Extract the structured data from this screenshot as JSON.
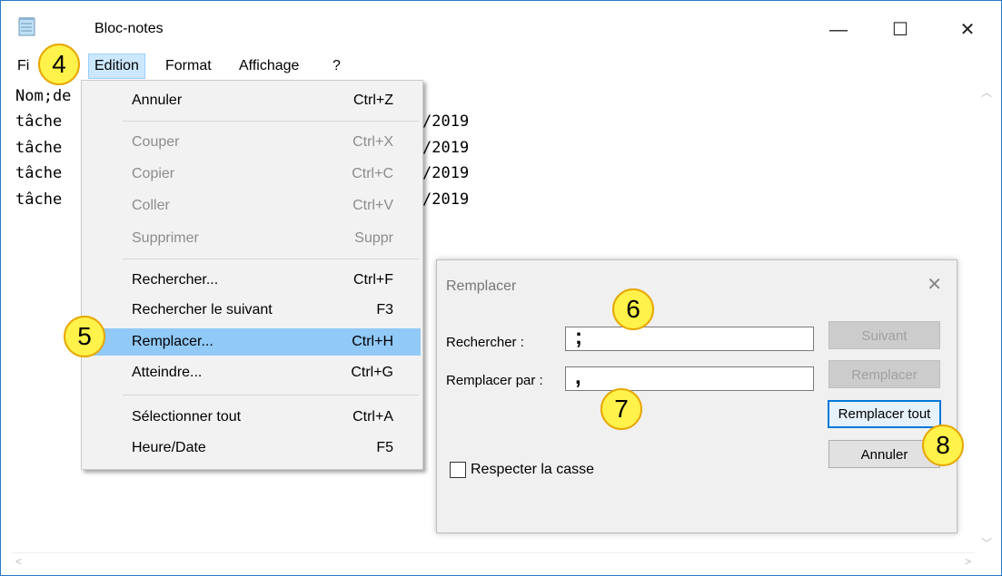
{
  "window": {
    "title": "Bloc-notes",
    "controls": {
      "minimize": "—",
      "maximize": "☐",
      "close": "✕"
    }
  },
  "menubar": {
    "items": [
      "Fi",
      "Edition",
      "Format",
      "Affichage",
      "?"
    ]
  },
  "editor": {
    "lines": [
      "Nom;de",
      "tâche",
      "tâche",
      "tâche",
      "tâche"
    ],
    "tail": [
      "/2019",
      "/2019",
      "/2019",
      "/2019"
    ]
  },
  "edit_menu": {
    "items": [
      {
        "label": "Annuler",
        "shortcut": "Ctrl+Z"
      },
      {
        "label": "Couper",
        "shortcut": "Ctrl+X"
      },
      {
        "label": "Copier",
        "shortcut": "Ctrl+C"
      },
      {
        "label": "Coller",
        "shortcut": "Ctrl+V"
      },
      {
        "label": "Supprimer",
        "shortcut": "Suppr"
      },
      {
        "label": "Rechercher...",
        "shortcut": "Ctrl+F"
      },
      {
        "label": "Rechercher le suivant",
        "shortcut": "F3"
      },
      {
        "label": "Remplacer...",
        "shortcut": "Ctrl+H"
      },
      {
        "label": "Atteindre...",
        "shortcut": "Ctrl+G"
      },
      {
        "label": "Sélectionner tout",
        "shortcut": "Ctrl+A"
      },
      {
        "label": "Heure/Date",
        "shortcut": "F5"
      }
    ]
  },
  "dialog": {
    "title": "Remplacer",
    "find_label": "Rechercher :",
    "find_value": ";",
    "replace_label": "Remplacer par :",
    "replace_value": ",",
    "match_case_label": "Respecter la casse",
    "btn_next": "Suivant",
    "btn_replace": "Remplacer",
    "btn_replace_all": "Remplacer tout",
    "btn_cancel": "Annuler"
  },
  "badges": [
    "4",
    "5",
    "6",
    "7",
    "8"
  ],
  "colors": {
    "badge_fill": "#fff24a",
    "badge_border": "#e8a600",
    "menu_highlight": "#91c9f7",
    "menubar_active": "#cce8ff"
  }
}
